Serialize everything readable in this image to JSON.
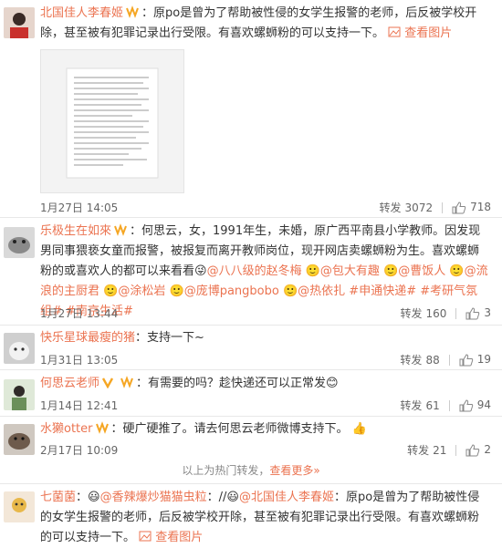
{
  "comments": [
    {
      "user": "北国佳人李春姬",
      "text": "：原po是曾为了帮助被性侵的女学生报警的老师，后反被学校开除，甚至被有犯罪记录出行受限。有喜欢螺蛳粉的可以支持一下。",
      "view_pic": "查看图片",
      "time": "1月27日 14:05",
      "repost_label": "转发",
      "repost_count": "3072",
      "like_count": "718"
    },
    {
      "user": "乐极生在如來",
      "text": "：何思云，女，1991年生，未婚，原广西平南县小学教师。因发现男同事猥亵女童而报警，被报复而离开教师岗位，现开网店卖螺蛳粉为生。喜欢螺蛳粉的或喜欢人的都可以来看看",
      "mentions": [
        "@八八级的赵冬梅",
        "@包大有趣",
        "@曹饭人",
        "@流浪的主厨君",
        "@涂松岩",
        "@庞博pangbobo",
        "@热依扎",
        "#申通快递#",
        "#考研气氛组#",
        "#南京生活#"
      ],
      "time": "1月27日 13:44",
      "repost_label": "转发",
      "repost_count": "160",
      "like_count": "3"
    },
    {
      "user": "快乐星球最瘦的猪",
      "text": "：支持一下~",
      "time": "1月31日 13:05",
      "repost_label": "转发",
      "repost_count": "88",
      "like_count": "19"
    },
    {
      "user": "何思云老师",
      "text": "：有需要的吗？趁快递还可以正常发",
      "time": "1月14日 12:41",
      "repost_label": "转发",
      "repost_count": "61",
      "like_count": "94"
    },
    {
      "user": "水獭otter",
      "text": "：硬广硬推了。请去何思云老师微博支持下。",
      "time": "2月17日 10:09",
      "repost_label": "转发",
      "repost_count": "21",
      "like_count": "2"
    },
    {
      "user": "七菌菌",
      "text_mid": "//",
      "mention1": "@香辣爆炒猫猫虫粒",
      "mention2": "@北国佳人李春姬",
      "text": "原po是曾为了帮助被性侵的女学生报警的老师，后反被学校开除，甚至被有犯罪记录出行受限。有喜欢螺蛳粉的可以支持一下。",
      "view_pic": "查看图片"
    }
  ],
  "more_bar": {
    "prefix": "以上为热门转发，",
    "link": "查看更多»"
  },
  "colors": {
    "accent": "#eb7350",
    "text": "#333333",
    "meta": "#666666"
  }
}
